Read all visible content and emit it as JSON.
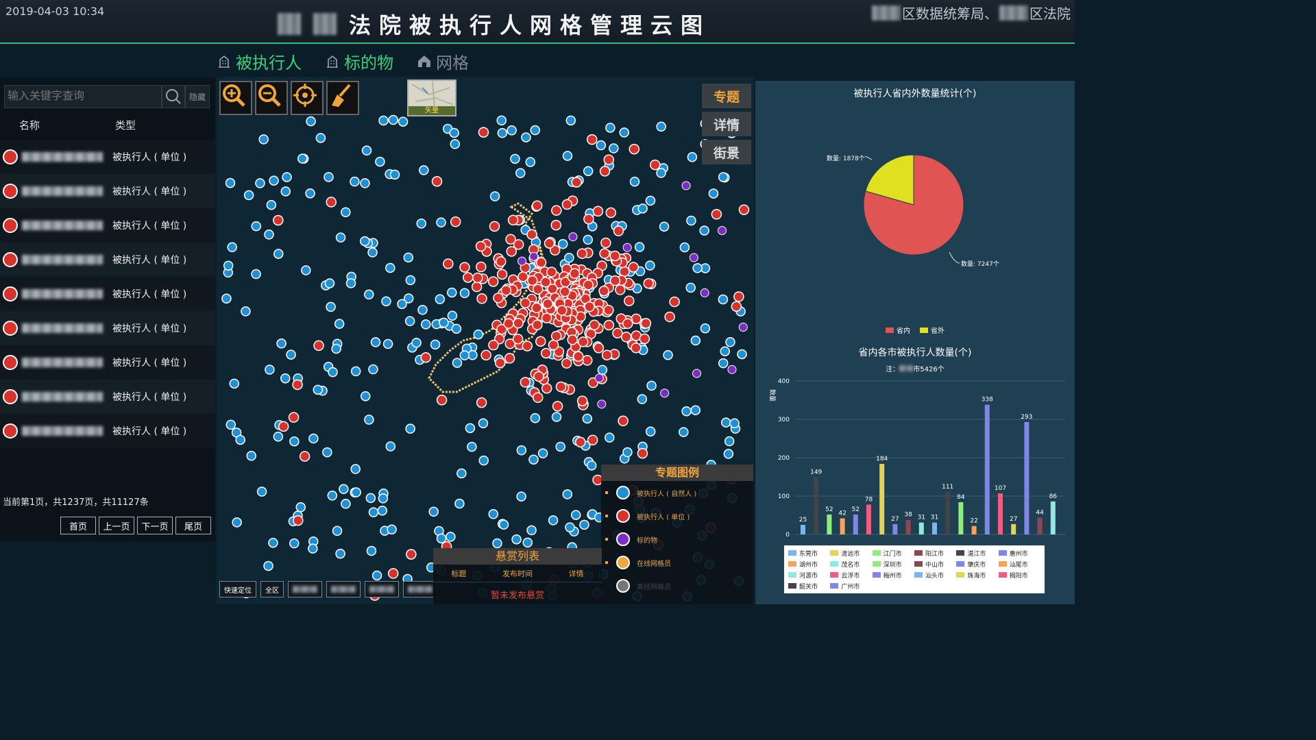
{
  "header": {
    "datetime": "2019-04-03 10:34",
    "title": "法院被执行人网格管理云图",
    "credit_a": "区数据统筹局、",
    "credit_b": "区法院"
  },
  "tabs": [
    {
      "label": "被执行人",
      "state": "active"
    },
    {
      "label": "标的物",
      "state": "active"
    },
    {
      "label": "网格",
      "state": "inactive"
    }
  ],
  "search": {
    "placeholder": "输入关键字查询",
    "hide_label": "隐藏"
  },
  "table": {
    "headers": [
      "名称",
      "类型"
    ],
    "rows": [
      {
        "type": "被执行人 ( 单位 )"
      },
      {
        "type": "被执行人 ( 单位 )"
      },
      {
        "type": "被执行人 ( 单位 )"
      },
      {
        "type": "被执行人 ( 单位 )"
      },
      {
        "type": "被执行人 ( 单位 )"
      },
      {
        "type": "被执行人 ( 单位 )"
      },
      {
        "type": "被执行人 ( 单位 )"
      },
      {
        "type": "被执行人 ( 单位 )"
      },
      {
        "type": "被执行人 ( 单位 )"
      }
    ]
  },
  "pager": {
    "info": "当前第1页，共1237页，共11127条",
    "first": "首页",
    "prev": "上一页",
    "next": "下一页",
    "last": "尾页"
  },
  "map": {
    "layer_label": "矢量",
    "side_buttons": [
      "专题",
      "详情",
      "街景"
    ],
    "legend_title": "专题图例",
    "legend": [
      {
        "label": "被执行人 ( 自然人 )",
        "color": "#1e90d6"
      },
      {
        "label": "被执行人 ( 单位 )",
        "color": "#d7322b"
      },
      {
        "label": "标的物",
        "color": "#7b2fc2"
      },
      {
        "label": "在线网格员",
        "color": "#f0a63a"
      },
      {
        "label": "离线网格员",
        "color": "#777777"
      }
    ],
    "reward_title": "悬赏列表",
    "reward_headers": [
      "标题",
      "发布时间",
      "详情"
    ],
    "reward_empty": "暂未发布悬赏",
    "quick_locate": "快速定位",
    "all_area": "全区"
  },
  "pie": {
    "title": "被执行人省内外数量统计(个)",
    "label_out": "数量: 1878个",
    "label_in": "数量: 7247个",
    "legend": [
      "省内",
      "省外"
    ]
  },
  "bar": {
    "title": "省内各市被执行人数量(个)",
    "note_prefix": "注：",
    "note_suffix": "市5426个",
    "ylabel": "数量"
  },
  "colors": {
    "accent": "#2ec27e",
    "orange": "#f0a63a",
    "red": "#d7322b",
    "blue": "#1e90d6"
  },
  "chart_data": [
    {
      "type": "pie",
      "title": "被执行人省内外数量统计(个)",
      "categories": [
        "省内",
        "省外"
      ],
      "values": [
        7247,
        1878
      ],
      "colors": [
        "#e05454",
        "#e0e020"
      ]
    },
    {
      "type": "bar",
      "title": "省内各市被执行人数量(个)",
      "ylabel": "数量",
      "ylim": [
        0,
        400
      ],
      "yticks": [
        0,
        100,
        200,
        300,
        400
      ],
      "categories": [
        "东莞市",
        "清远市",
        "江门市",
        "阳江市",
        "湛江市",
        "惠州市",
        "湖州市",
        "茂名市",
        "深圳市",
        "中山市",
        "肇庆市",
        "汕尾市",
        "河源市",
        "云浮市",
        "梅州市",
        "汕头市",
        "珠海市",
        "揭阳市",
        "韶关市",
        "广州市"
      ],
      "bars": [
        {
          "name": "东莞市",
          "value": 25,
          "color": "#7cb5ec"
        },
        {
          "name": "湛江市",
          "value": 149,
          "color": "#434348"
        },
        {
          "name": "深圳市",
          "value": 52,
          "color": "#90ed7d"
        },
        {
          "name": "汕尾市",
          "value": 42,
          "color": "#f7a35c"
        },
        {
          "name": "梅州市",
          "value": 52,
          "color": "#8085e9"
        },
        {
          "name": "揭阳市",
          "value": 78,
          "color": "#f15c80"
        },
        {
          "name": "清远市",
          "value": 184,
          "color": "#e4d354"
        },
        {
          "name": "惠州市",
          "value": 27,
          "color": "#8085e8"
        },
        {
          "name": "中山市",
          "value": 38,
          "color": "#8d4653"
        },
        {
          "name": "河源市",
          "value": 31,
          "color": "#91e8e1"
        },
        {
          "name": "汕头市",
          "value": 31,
          "color": "#7cb5ec"
        },
        {
          "name": "韶关市",
          "value": 111,
          "color": "#434348"
        },
        {
          "name": "江门市",
          "value": 84,
          "color": "#90ed7d"
        },
        {
          "name": "湖州市",
          "value": 22,
          "color": "#f7a35c"
        },
        {
          "name": "肇庆市",
          "value": 338,
          "color": "#8085e9"
        },
        {
          "name": "云浮市",
          "value": 107,
          "color": "#f15c80"
        },
        {
          "name": "珠海市",
          "value": 27,
          "color": "#e4d354"
        },
        {
          "name": "广州市",
          "value": 293,
          "color": "#8085e8"
        },
        {
          "name": "阳江市",
          "value": 44,
          "color": "#8d4653"
        },
        {
          "name": "茂名市",
          "value": 86,
          "color": "#91e8e1"
        }
      ]
    }
  ]
}
